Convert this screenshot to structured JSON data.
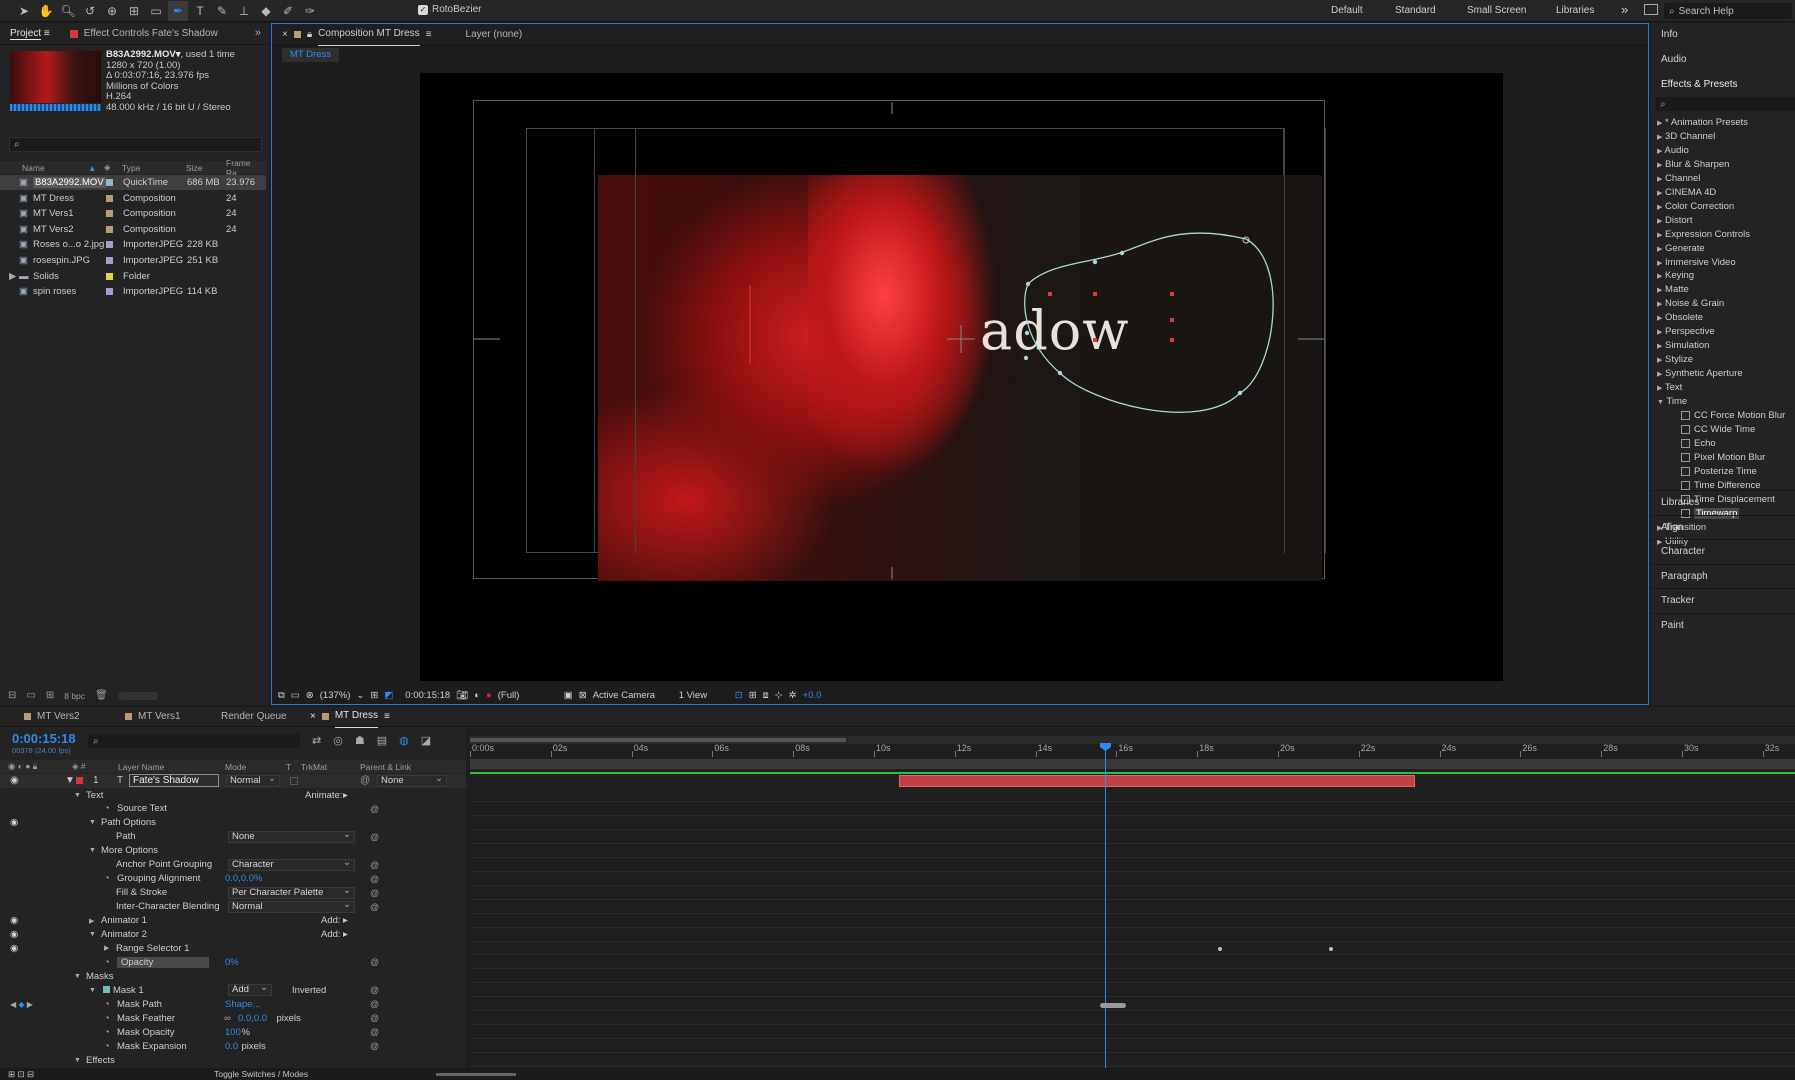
{
  "toolbar": {
    "rotobezier_label": "RotoBezier",
    "workspaces": [
      "Default",
      "Standard",
      "Small Screen",
      "Libraries"
    ],
    "more": "»",
    "search_placeholder": "Search Help"
  },
  "project": {
    "tab_project": "Project",
    "tab_effect_controls": "Effect Controls Fate's Shadow",
    "selected_name": "B83A2992.MOV▾",
    "used": ", used 1 time",
    "info_lines": [
      "1280 x 720 (1.00)",
      "Δ 0:03:07:16, 23.976 fps",
      "Millions of Colors",
      "H.264",
      "48.000 kHz / 16 bit U / Stereo"
    ],
    "columns": {
      "name": "Name",
      "type": "Type",
      "size": "Size",
      "frame_rate": "Frame Ra..."
    },
    "items": [
      {
        "name": "B83A2992.MOV",
        "type": "QuickTime",
        "size": "686 MB",
        "fr": "23.976",
        "color": "#8fb7c4"
      },
      {
        "name": "MT Dress",
        "type": "Composition",
        "size": "",
        "fr": "24",
        "color": "#b79a77"
      },
      {
        "name": "MT Vers1",
        "type": "Composition",
        "size": "",
        "fr": "24",
        "color": "#b79a77"
      },
      {
        "name": "MT Vers2",
        "type": "Composition",
        "size": "",
        "fr": "24",
        "color": "#b79a77"
      },
      {
        "name": "Roses o...o 2.jpg",
        "type": "ImporterJPEG",
        "size": "228 KB",
        "fr": "",
        "color": "#a99bd1"
      },
      {
        "name": "rosespin.JPG",
        "type": "ImporterJPEG",
        "size": "251 KB",
        "fr": "",
        "color": "#a99bd1"
      },
      {
        "name": "Solids",
        "type": "Folder",
        "size": "",
        "fr": "",
        "color": "#e6d14a"
      },
      {
        "name": "spin roses",
        "type": "ImporterJPEG",
        "size": "114 KB",
        "fr": "",
        "color": "#a99bd1"
      }
    ],
    "bpc": "8 bpc"
  },
  "comp": {
    "tab_label": "Composition MT Dress",
    "layer_tab": "Layer (none)",
    "sub_tab": "MT Dress",
    "overlay_text": "adow",
    "footer": {
      "zoom": "(137%)",
      "timecode": "0:00:15:18",
      "resolution": "(Full)",
      "camera": "Active Camera",
      "views": "1 View",
      "exposure": "+0.0"
    }
  },
  "right_panel": {
    "headers": [
      "Info",
      "Audio",
      "Effects & Presets"
    ],
    "categories": [
      "* Animation Presets",
      "3D Channel",
      "Audio",
      "Blur & Sharpen",
      "Channel",
      "CINEMA 4D",
      "Color Correction",
      "Distort",
      "Expression Controls",
      "Generate",
      "Immersive Video",
      "Keying",
      "Matte",
      "Noise & Grain",
      "Obsolete",
      "Perspective",
      "Simulation",
      "Stylize",
      "Synthetic Aperture",
      "Text",
      "Time"
    ],
    "time_effects": [
      "CC Force Motion Blur",
      "CC Wide Time",
      "Echo",
      "Pixel Motion Blur",
      "Posterize Time",
      "Time Difference",
      "Time Displacement",
      "Timewarp"
    ],
    "after": [
      "Transition",
      "Utility"
    ],
    "bottom_panels": [
      "Libraries",
      "Align",
      "Character",
      "Paragraph",
      "Tracker",
      "Paint"
    ]
  },
  "timeline": {
    "tabs": [
      "MT Vers2",
      "MT Vers1",
      "Render Queue",
      "MT Dress"
    ],
    "timecode": "0:00:15:18",
    "frame_info": "00378 (24.00 fps)",
    "headers": {
      "layer_name": "Layer Name",
      "mode": "Mode",
      "t": "T",
      "trkmat": "TrkMat",
      "parent": "Parent & Link"
    },
    "ruler": [
      "0:00s",
      "02s",
      "04s",
      "06s",
      "08s",
      "10s",
      "12s",
      "14s",
      "16s",
      "18s",
      "20s",
      "22s",
      "24s",
      "26s",
      "28s",
      "30s",
      "32s"
    ],
    "layer": {
      "num": "1",
      "name": "Fate's Shadow",
      "mode": "Normal",
      "parent": "None"
    },
    "rows": [
      {
        "label": "Text",
        "indent": 1,
        "tw": "▼",
        "right": "Animate:"
      },
      {
        "label": "Source Text",
        "indent": 3,
        "sw": true
      },
      {
        "label": "Path Options",
        "indent": 2,
        "tw": "▼",
        "eye": true
      },
      {
        "label": "Path",
        "indent": 3,
        "dd": "None"
      },
      {
        "label": "More Options",
        "indent": 2,
        "tw": "▼"
      },
      {
        "label": "Anchor Point Grouping",
        "indent": 3,
        "dd": "Character"
      },
      {
        "label": "Grouping Alignment",
        "indent": 3,
        "sw": true,
        "val": "0.0,0.0%"
      },
      {
        "label": "Fill & Stroke",
        "indent": 3,
        "dd": "Per Character Palette"
      },
      {
        "label": "Inter-Character Blending",
        "indent": 3,
        "dd": "Normal"
      },
      {
        "label": "Animator 1",
        "indent": 2,
        "tw": "▶",
        "eye": true,
        "right": "Add:"
      },
      {
        "label": "Animator 2",
        "indent": 2,
        "tw": "▼",
        "eye": true,
        "right": "Add:"
      },
      {
        "label": "Range Selector 1",
        "indent": 3,
        "tw": "▶",
        "eye": true
      },
      {
        "label": "Opacity",
        "indent": 3,
        "sw": true,
        "val": "0%",
        "boxed": true
      },
      {
        "label": "Masks",
        "indent": 1,
        "tw": "▼"
      },
      {
        "label": "Mask 1",
        "indent": 2,
        "tw": "▼",
        "mask": true,
        "dd": "Add",
        "extra": "Inverted"
      },
      {
        "label": "Mask Path",
        "indent": 3,
        "sw": true,
        "val": "Shape...",
        "kf": true
      },
      {
        "label": "Mask Feather",
        "indent": 3,
        "sw": true,
        "val": "0.0,0.0",
        "unit": " pixels"
      },
      {
        "label": "Mask Opacity",
        "indent": 3,
        "sw": true,
        "val": "100",
        "unit": "%"
      },
      {
        "label": "Mask Expansion",
        "indent": 3,
        "sw": true,
        "val": "0.0",
        "unit": " pixels"
      },
      {
        "label": "Effects",
        "indent": 1,
        "tw": "▼"
      }
    ],
    "toggle_label": "Toggle Switches / Modes",
    "playhead_time_s": 15.75
  }
}
